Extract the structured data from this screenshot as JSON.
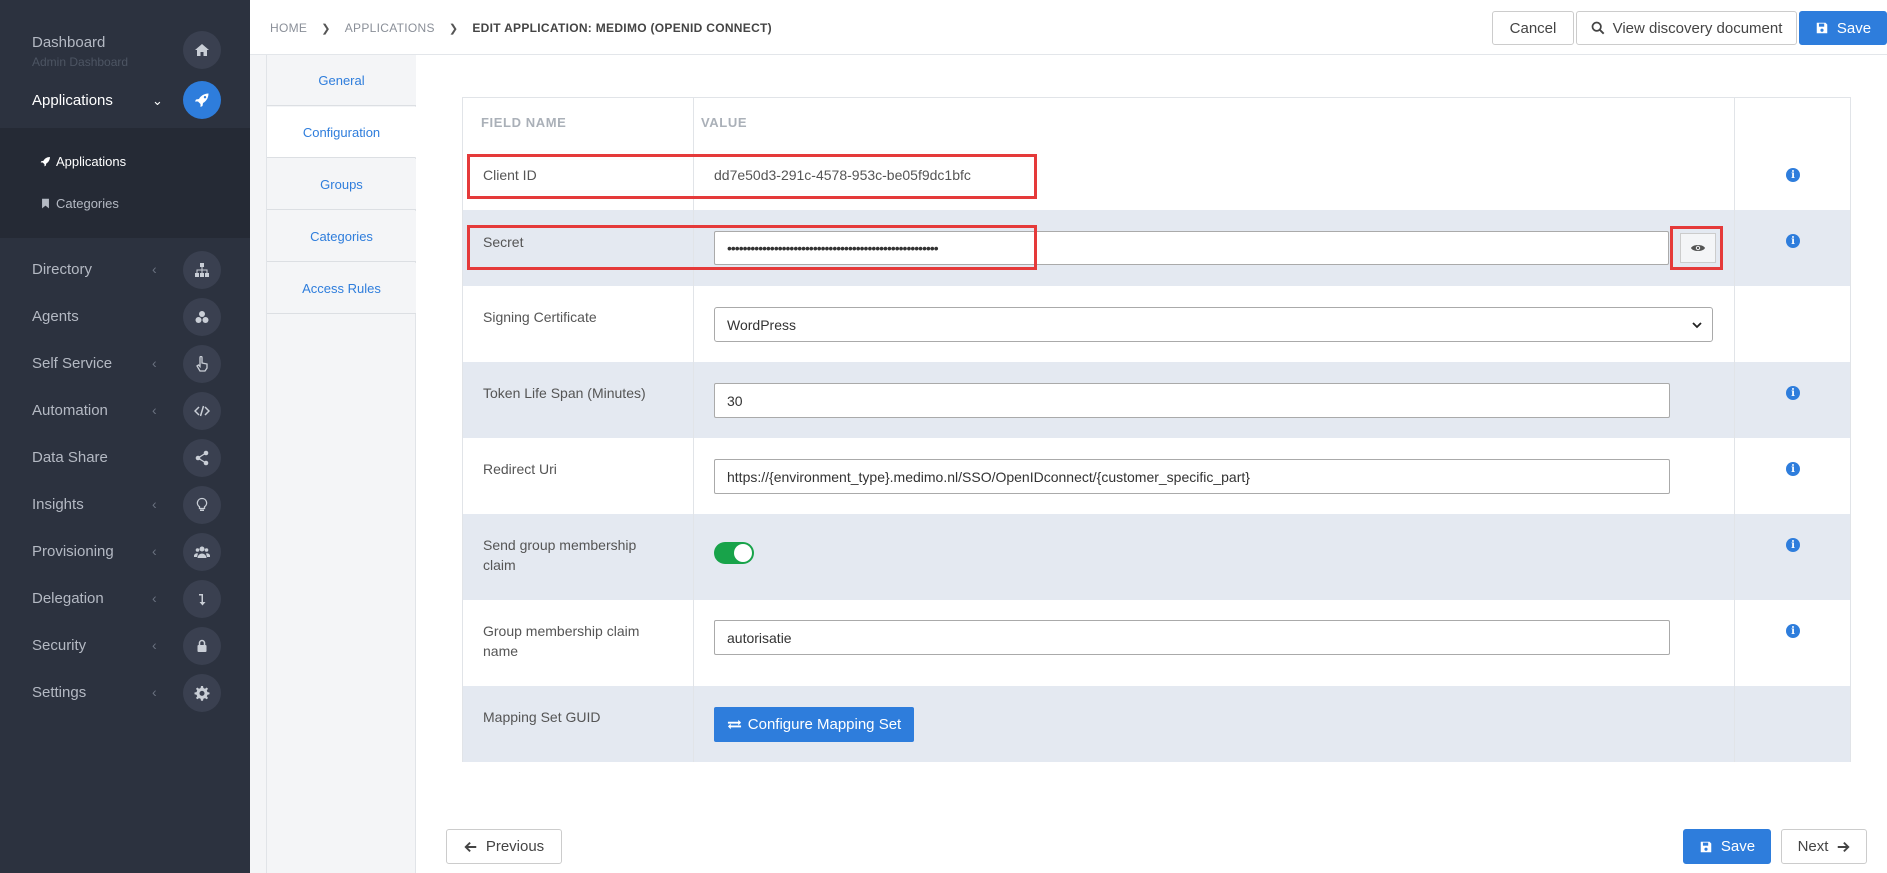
{
  "sidebar": {
    "dashboard": {
      "title": "Dashboard",
      "subtitle": "Admin Dashboard"
    },
    "applications": {
      "label": "Applications",
      "sub_items": [
        {
          "label": "Applications"
        },
        {
          "label": "Categories"
        }
      ]
    },
    "items": [
      {
        "label": "Directory",
        "icon": "sitemap-icon",
        "chevron": true
      },
      {
        "label": "Agents",
        "icon": "cubes-icon",
        "chevron": false
      },
      {
        "label": "Self Service",
        "icon": "hand-pointer-icon",
        "chevron": true
      },
      {
        "label": "Automation",
        "icon": "code-icon",
        "chevron": true
      },
      {
        "label": "Data Share",
        "icon": "share-icon",
        "chevron": false
      },
      {
        "label": "Insights",
        "icon": "lightbulb-icon",
        "chevron": true
      },
      {
        "label": "Provisioning",
        "icon": "users-icon",
        "chevron": true
      },
      {
        "label": "Delegation",
        "icon": "level-down-icon",
        "chevron": true
      },
      {
        "label": "Security",
        "icon": "lock-icon",
        "chevron": true
      },
      {
        "label": "Settings",
        "icon": "gear-icon",
        "chevron": true
      }
    ]
  },
  "breadcrumb": {
    "home": "HOME",
    "applications": "APPLICATIONS",
    "current": "EDIT APPLICATION: MEDIMO (OPENID CONNECT)"
  },
  "toolbar": {
    "cancel": "Cancel",
    "discovery": "View discovery document",
    "save": "Save"
  },
  "tabs": [
    {
      "label": "General",
      "active": false
    },
    {
      "label": "Configuration",
      "active": true
    },
    {
      "label": "Groups",
      "active": false
    },
    {
      "label": "Categories",
      "active": false
    },
    {
      "label": "Access Rules",
      "active": false
    }
  ],
  "table": {
    "headers": {
      "field": "FIELD NAME",
      "value": "VALUE"
    },
    "rows": {
      "client_id": {
        "label": "Client ID",
        "value": "dd7e50d3-291c-4578-953c-be05f9dc1bfc"
      },
      "secret": {
        "label": "Secret",
        "value": "••••••••••••••••••••••••••••••••••••••••••••••••••••••"
      },
      "signing": {
        "label": "Signing Certificate",
        "value": "WordPress"
      },
      "token": {
        "label": "Token Life Span (Minutes)",
        "value": "30"
      },
      "redirect": {
        "label": "Redirect Uri",
        "value": "https://{environment_type}.medimo.nl/SSO/OpenIDconnect/{customer_specific_part}"
      },
      "send_group": {
        "label": "Send group membership claim",
        "value": true
      },
      "group_claim": {
        "label": "Group membership claim name",
        "value": "autorisatie"
      },
      "mapping": {
        "label": "Mapping Set GUID",
        "button": "Configure Mapping Set"
      }
    }
  },
  "footer": {
    "previous": "Previous",
    "save": "Save",
    "next": "Next"
  },
  "colors": {
    "accent": "#2e7ddc",
    "sidebar": "#2c323f",
    "highlight": "#e53a3a",
    "toggle_on": "#18a34a"
  }
}
